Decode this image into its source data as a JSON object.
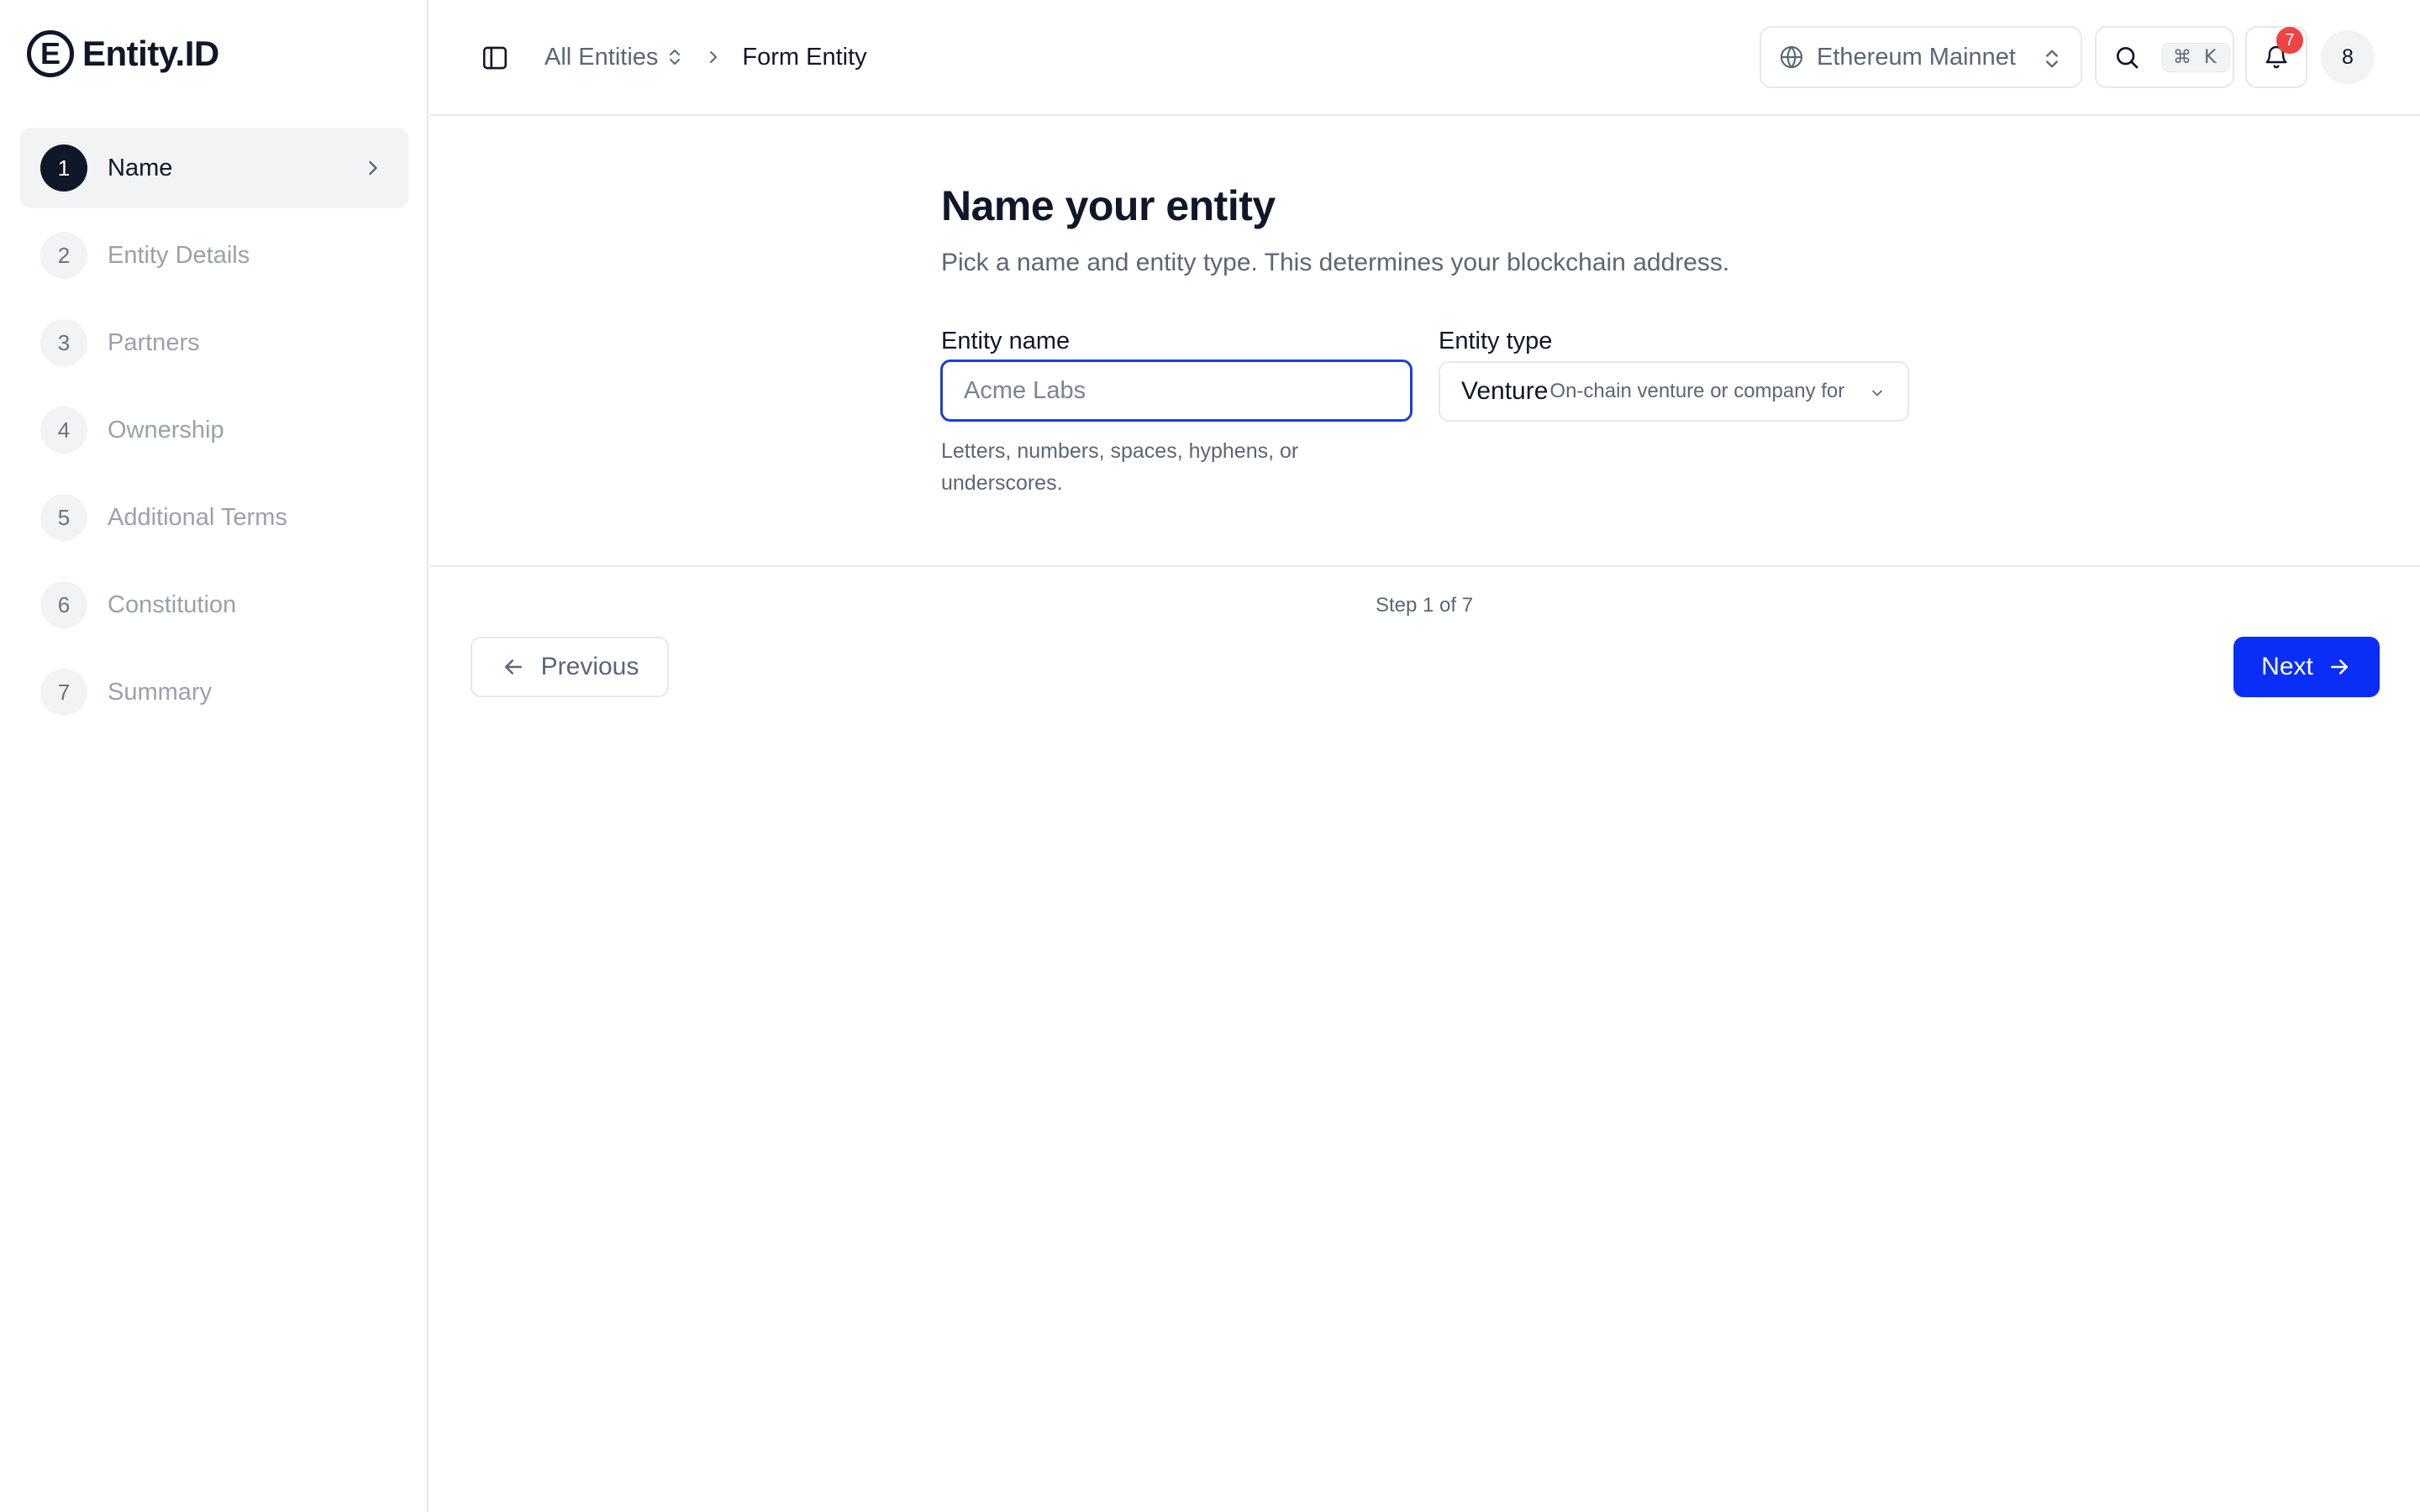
{
  "brand": {
    "logo_letter": "E",
    "name": "Entity.ID"
  },
  "sidebar": {
    "steps": [
      {
        "number": "1",
        "label": "Name",
        "active": true
      },
      {
        "number": "2",
        "label": "Entity Details",
        "active": false
      },
      {
        "number": "3",
        "label": "Partners",
        "active": false
      },
      {
        "number": "4",
        "label": "Ownership",
        "active": false
      },
      {
        "number": "5",
        "label": "Additional Terms",
        "active": false
      },
      {
        "number": "6",
        "label": "Constitution",
        "active": false
      },
      {
        "number": "7",
        "label": "Summary",
        "active": false
      }
    ]
  },
  "header": {
    "breadcrumb": {
      "root": "All Entities",
      "current": "Form Entity"
    },
    "network": "Ethereum Mainnet",
    "search_shortcut": "⌘ K",
    "notifications_count": "7",
    "avatar_initial": "8"
  },
  "form": {
    "title": "Name your entity",
    "subtitle": "Pick a name and entity type. This determines your blockchain address.",
    "name_label": "Entity name",
    "name_placeholder": "Acme Labs",
    "name_value": "",
    "name_hint": "Letters, numbers, spaces, hyphens, or underscores.",
    "type_label": "Entity type",
    "type_value": "Venture",
    "type_description": "On-chain venture or company for"
  },
  "footer": {
    "step_indicator": "Step 1 of 7",
    "previous_label": "Previous",
    "next_label": "Next"
  },
  "colors": {
    "primary": "#0a2ef7",
    "focus_border": "#1d3fd6",
    "badge": "#ef4444",
    "text_dark": "#0f1729",
    "text_muted": "#5b6676",
    "border": "#e6e8ec"
  }
}
